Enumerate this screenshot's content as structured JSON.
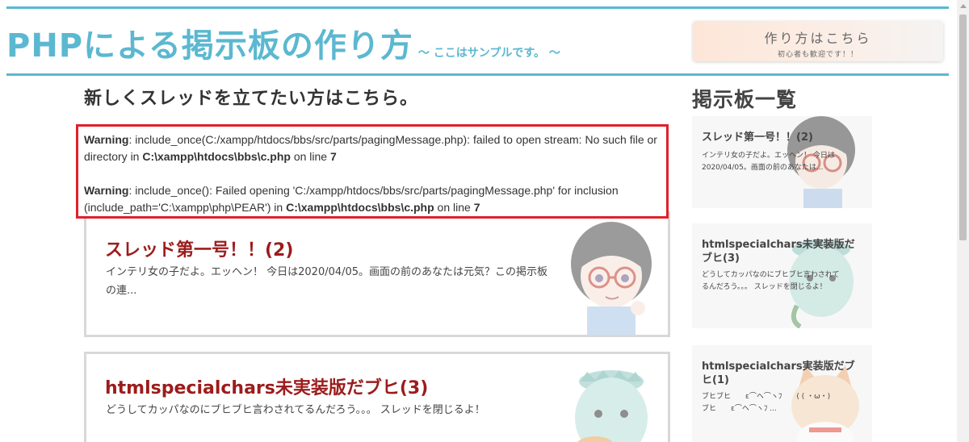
{
  "header": {
    "title": "PHPによる掲示板の作り方",
    "subtitle": "～ ここはサンプルです。 ～",
    "howto_button": {
      "label": "作り方はこちら",
      "sub": "初心者も歓迎です！！"
    }
  },
  "main": {
    "new_thread_heading_prefix": "新しくスレッドを立てたい方は",
    "new_thread_link": "こちら。",
    "warnings": [
      {
        "label": "Warning",
        "text": ": include_once(C:/xampp/htdocs/bbs/src/parts/pagingMessage.php): failed to open stream: No such file or directory in ",
        "file": "C:\\xampp\\htdocs\\bbs\\c.php",
        "on_line": " on line ",
        "line": "7"
      },
      {
        "label": "Warning",
        "text": ": include_once(): Failed opening 'C:/xampp/htdocs/bbs/src/parts/pagingMessage.php' for inclusion (include_path='C:\\xampp\\php\\PEAR') in ",
        "file": "C:\\xampp\\htdocs\\bbs\\c.php",
        "on_line": " on line ",
        "line": "7"
      }
    ],
    "threads": [
      {
        "title": "スレッド第一号！！(2)",
        "body": "インテリ女の子だよ。エッヘン！ 今日は2020/04/05。画面の前のあなたは元気？この掲示板の連..."
      },
      {
        "title": "htmlspecialchars未実装版だブヒ(3)",
        "body": "どうしてカッパなのにブヒブヒ言わされてるんだろう。。。 スレッドを閉じるよ！"
      }
    ]
  },
  "sidebar": {
    "title": "掲示板一覧",
    "cards": [
      {
        "title": "スレッド第一号！！(2)",
        "body": "インテリ女の子だよ。エッヘン！ 今日は2020/04/05。画面の前のあなたは..."
      },
      {
        "title": "htmlspecialchars未実装版だブヒ(3)",
        "body": "どうしてカッパなのにブヒブヒ言わされてるんだろう。。。 スレッドを閉じるよ！"
      },
      {
        "title": "htmlspecialchars実装版だブヒ(1)",
        "body": "ブヒブヒ　　ε⌒ヘ⌒ヽﾌ　　(  ( ・ω・)　ブヒ　　ε⌒ヘ⌒ヽﾌ ..."
      }
    ]
  },
  "colors": {
    "accent": "#5bb8d0",
    "thread_title": "#9c1c1c",
    "warning_border": "#e0202a"
  }
}
